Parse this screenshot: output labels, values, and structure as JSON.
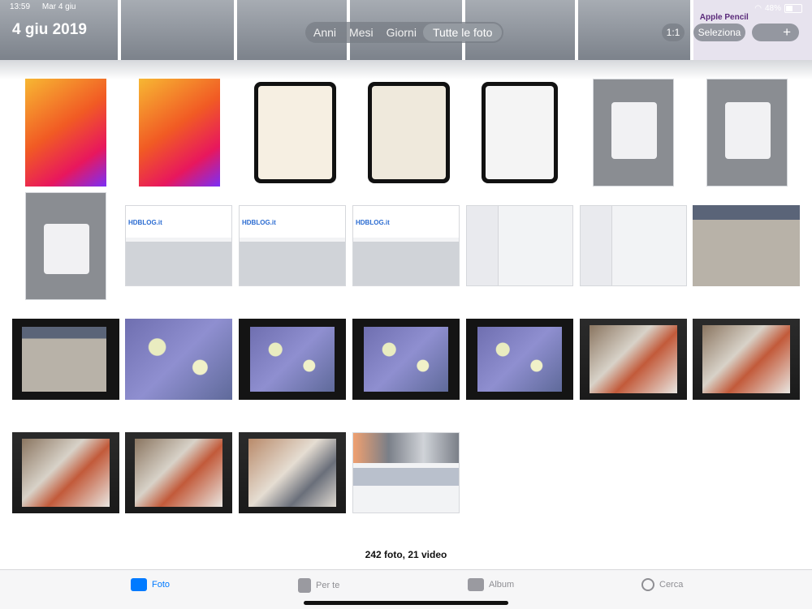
{
  "status": {
    "time": "13:59",
    "date": "Mar 4 giu",
    "battery": "48%",
    "battery_level": 0.48
  },
  "header": {
    "date_title": "4 giu 2019"
  },
  "segments": [
    {
      "label": "Anni",
      "active": false
    },
    {
      "label": "Mesi",
      "active": false
    },
    {
      "label": "Giorni",
      "active": false
    },
    {
      "label": "Tutte le foto",
      "active": true
    }
  ],
  "toolbar": {
    "aspect_label": "1:1",
    "select_label": "Seleziona",
    "add_label": "+"
  },
  "top_strip_text": "Apple Pencil",
  "hd_logo": "HDBLOG.it",
  "photos_summary": "242 foto, 21 video",
  "tabs": [
    {
      "label": "Foto",
      "icon": "photos-icon",
      "active": true
    },
    {
      "label": "Per te",
      "icon": "for-you-icon",
      "active": false
    },
    {
      "label": "Album",
      "icon": "album-icon",
      "active": false
    },
    {
      "label": "Cerca",
      "icon": "search-icon",
      "active": false
    }
  ],
  "colors": {
    "accent": "#007aff",
    "background": "#ffffff",
    "tabbar": "#f6f6f7"
  }
}
